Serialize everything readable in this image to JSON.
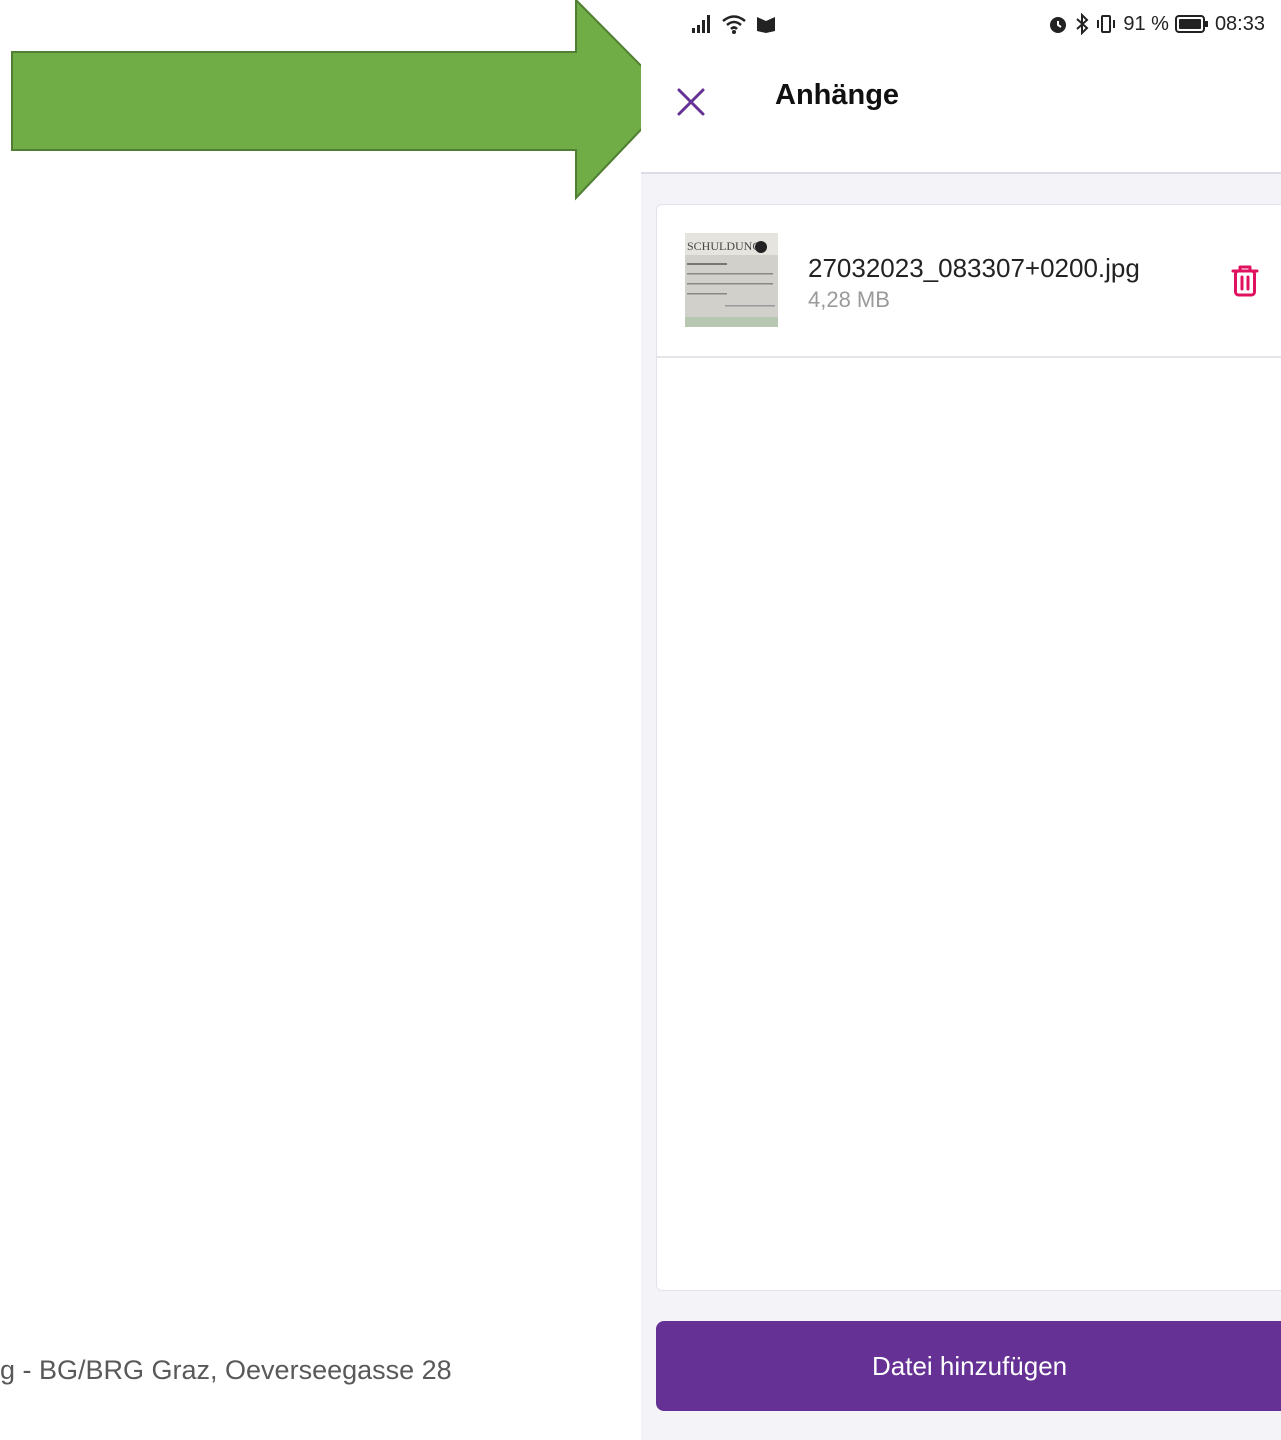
{
  "colors": {
    "arrow_fill": "#70ad47",
    "arrow_stroke": "#507e32",
    "accent": "#663195",
    "delete": "#e0115f"
  },
  "footer": {
    "text": "g  -  BG/BRG Graz, Oeverseegasse 28"
  },
  "statusbar": {
    "battery_percent": "91 %",
    "time": "08:33",
    "icons": [
      "signal-icon",
      "wifi-icon",
      "notification-icon",
      "alarm-icon",
      "bluetooth-icon",
      "vibrate-icon",
      "battery-icon"
    ]
  },
  "appbar": {
    "title": "Anhänge",
    "close_icon": "close-icon"
  },
  "attachments": [
    {
      "name": "27032023_083307+0200.jpg",
      "size": "4,28 MB",
      "thumb_text": "SCHULDUNG"
    }
  ],
  "actions": {
    "add_file_label": "Datei hinzufügen"
  }
}
